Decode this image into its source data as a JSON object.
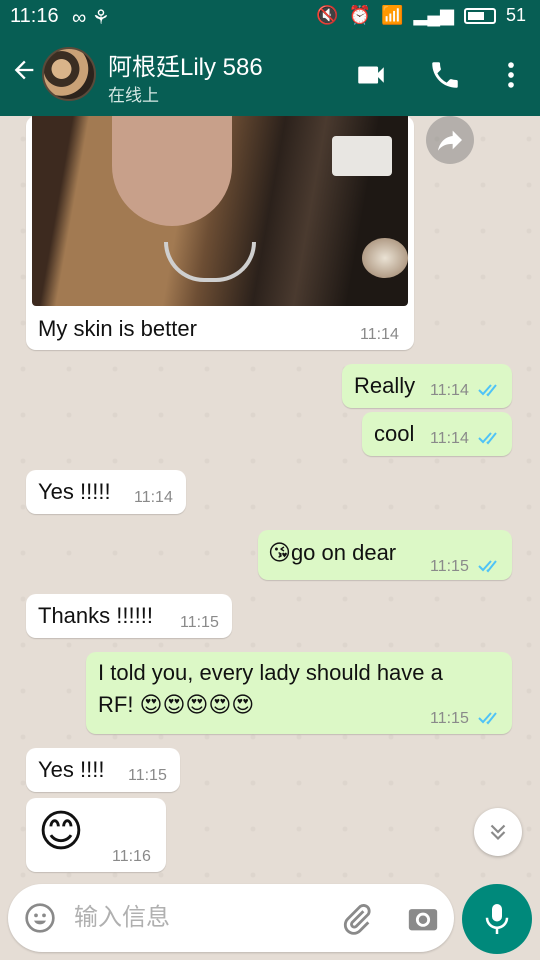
{
  "statusbar": {
    "time": "11:16",
    "battery": "51"
  },
  "chat_header": {
    "contact_name": "阿根廷Lily 586",
    "contact_status": "在线上"
  },
  "messages": [
    {
      "direction": "in",
      "text": "My skin is better",
      "time": "11:14"
    },
    {
      "direction": "out",
      "text": "Really",
      "time": "11:14"
    },
    {
      "direction": "out",
      "text": "cool",
      "time": "11:14"
    },
    {
      "direction": "in",
      "text": "Yes !!!!!",
      "time": "11:14"
    },
    {
      "direction": "out",
      "emoji": "😘",
      "text": "go on dear",
      "time": "11:15"
    },
    {
      "direction": "in",
      "text": "Thanks !!!!!!",
      "time": "11:15"
    },
    {
      "direction": "out",
      "text_line1": "I told you, every lady should have a",
      "text_line2": "RF! 😍😍😍😍😍",
      "time": "11:15"
    },
    {
      "direction": "in",
      "text": "Yes !!!!",
      "time": "11:15"
    },
    {
      "direction": "in",
      "emoji": "😊",
      "time": "11:16"
    }
  ],
  "composer": {
    "placeholder": "输入信息"
  },
  "colors": {
    "header": "#075e54",
    "outgoing_bubble": "#dcf8c6",
    "incoming_bubble": "#ffffff",
    "read_ticks": "#4fc3f7",
    "mic_button": "#00897b"
  }
}
